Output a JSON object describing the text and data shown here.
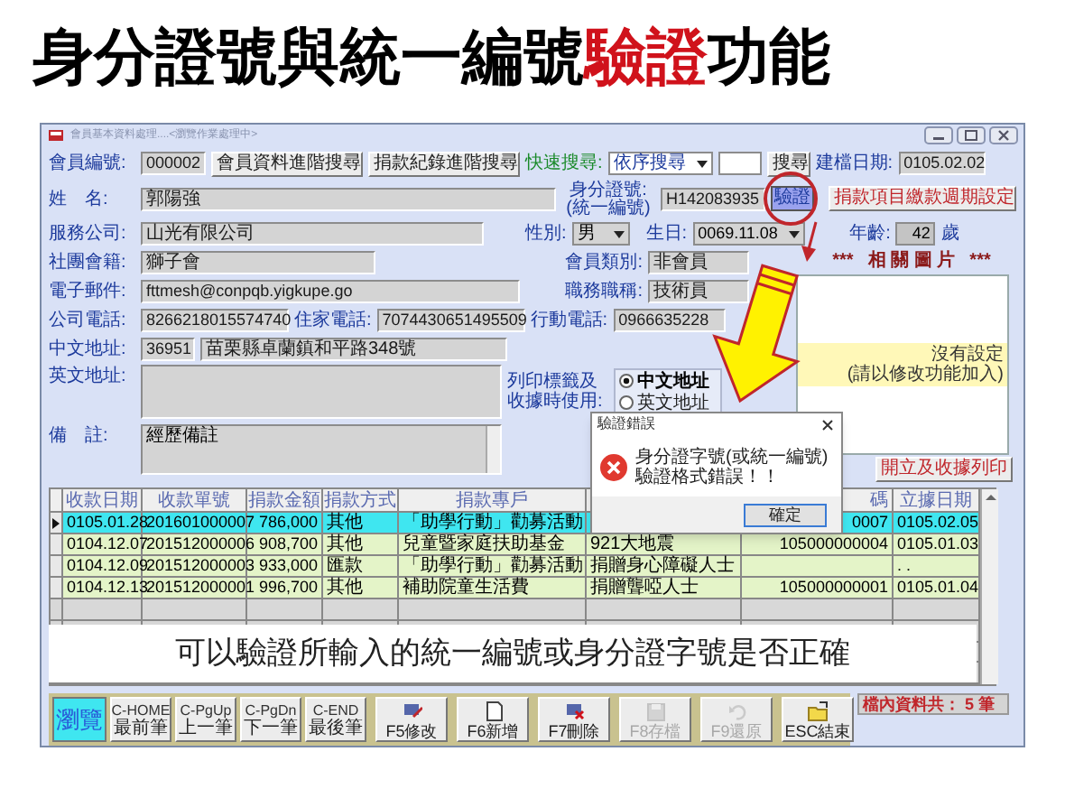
{
  "heading": {
    "parts": [
      {
        "text": "身分證號與統一編號",
        "highlight": false
      },
      {
        "text": "驗證",
        "highlight": true
      },
      {
        "text": "功能",
        "highlight": false
      }
    ]
  },
  "window": {
    "title": "會員基本資料處理....<瀏覽作業處理中>"
  },
  "form": {
    "member_no": {
      "label": "會員編號:",
      "value": "000002"
    },
    "search_buttons": [
      "會員資料進階搜尋",
      "捐款紀錄進階搜尋"
    ],
    "quick_search": {
      "label": "快速搜尋:",
      "value": "依序搜尋",
      "button": "搜尋"
    },
    "created_date": {
      "label": "建檔日期:",
      "value": "0105.02.02"
    },
    "name": {
      "label": "姓　名:",
      "value": "郭陽強"
    },
    "id_no": {
      "label": "身分證號:",
      "sublabel": "(統一編號)",
      "value": "H142083935",
      "button": "驗證"
    },
    "period_button": "捐款項目繳款週期設定",
    "company": {
      "label": "服務公司:",
      "value": "山光有限公司"
    },
    "gender": {
      "label": "性別:",
      "value": "男"
    },
    "birthday": {
      "label": "生日:",
      "value": "0069.11.08"
    },
    "age": {
      "label": "年齡:",
      "value": "42",
      "unit": "歲"
    },
    "club": {
      "label": "社團會籍:",
      "value": "獅子會"
    },
    "member_type": {
      "label": "會員類別:",
      "value": "非會員"
    },
    "email": {
      "label": "電子郵件:",
      "value": "fttmesh@conpqb.yigkupe.go"
    },
    "job_title": {
      "label": "職務職稱:",
      "value": "技術員"
    },
    "company_phone": {
      "label": "公司電話:",
      "value": "8266218015574740"
    },
    "home_phone": {
      "label": "住家電話:",
      "value": "7074430651495509"
    },
    "mobile": {
      "label": "行動電話:",
      "value": "0966635228"
    },
    "address_zh": {
      "label": "中文地址:",
      "zip": "36951",
      "value": "苗栗縣卓蘭鎮和平路348號"
    },
    "address_en": {
      "label": "英文地址:"
    },
    "print_option": {
      "label": "列印標籤及收據時使用:",
      "options": [
        {
          "label": "中文地址",
          "selected": true
        },
        {
          "label": "英文地址",
          "selected": false
        }
      ]
    },
    "note": {
      "label": "備　註:",
      "value": "經歷備註"
    }
  },
  "photo_panel": {
    "title_parts": [
      "***",
      "相 關 圖 片",
      "***"
    ],
    "note": [
      "沒有設定",
      "(請以修改功能加入)"
    ]
  },
  "print_button": "開立及收據列印",
  "table": {
    "columns": [
      {
        "label": "收款日期"
      },
      {
        "label": "收款單號"
      },
      {
        "label": "捐款金額"
      },
      {
        "label": "捐款方式"
      },
      {
        "label": "捐款專戶"
      },
      {},
      {
        "label": "碼"
      },
      {
        "label": "立據日期"
      }
    ],
    "rows": [
      {
        "selected": true,
        "cells": [
          "0105.01.28",
          "201601000007",
          "786,000",
          "其他",
          "「助學行動」勸募活動",
          null,
          "0007",
          "0105.02.05"
        ]
      },
      {
        "selected": false,
        "cells": [
          "0104.12.07",
          "201512000006",
          "908,700",
          "其他",
          "兒童暨家庭扶助基金",
          "921大地震",
          "105000000004",
          "0105.01.03"
        ]
      },
      {
        "selected": false,
        "cells": [
          "0104.12.09",
          "201512000003",
          "933,000",
          "匯款",
          "「助學行動」勸募活動",
          "捐贈身心障礙人士",
          null,
          ". ."
        ]
      },
      {
        "selected": false,
        "cells": [
          "0104.12.13",
          "201512000001",
          "996,700",
          "其他",
          "補助院童生活費",
          "捐贈聾啞人士",
          "105000000001",
          "0105.01.04"
        ]
      }
    ]
  },
  "caption": "可以驗證所輸入的統一編號或身分證字號是否正確",
  "toolbar": [
    {
      "kind": "mode",
      "label": "瀏覽",
      "selected": true
    },
    {
      "kind": "nav",
      "key": "C-HOME",
      "label": "最前筆"
    },
    {
      "kind": "nav",
      "key": "C-PgUp",
      "label": "上一筆"
    },
    {
      "kind": "nav",
      "key": "C-PgDn",
      "label": "下一筆"
    },
    {
      "kind": "nav",
      "key": "C-END",
      "label": "最後筆"
    },
    {
      "kind": "action",
      "label": "F5修改",
      "disabled": false
    },
    {
      "kind": "action",
      "label": "F6新增",
      "disabled": false
    },
    {
      "kind": "action",
      "label": "F7刪除",
      "disabled": false
    },
    {
      "kind": "action",
      "label": "F8存檔",
      "disabled": true
    },
    {
      "kind": "action",
      "label": "F9還原",
      "disabled": true
    },
    {
      "kind": "action",
      "label": "ESC結束",
      "disabled": false
    }
  ],
  "status": "檔內資料共： 5 筆",
  "dialog": {
    "title": "驗證錯誤",
    "message": "身分證字號(或統一編號)驗證格式錯誤！！",
    "button": "確定"
  }
}
